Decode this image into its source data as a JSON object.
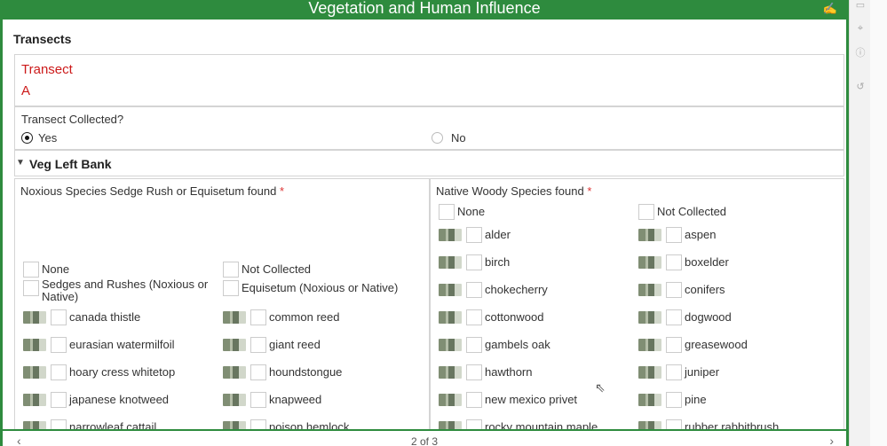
{
  "header": {
    "title": "Vegetation and Human Influence",
    "signature_icon": "signature-icon"
  },
  "group": {
    "title": "Transects"
  },
  "transect": {
    "label": "Transect",
    "value": "A"
  },
  "collected": {
    "question": "Transect Collected?",
    "options": [
      {
        "label": "Yes",
        "selected": true
      },
      {
        "label": "No",
        "selected": false
      }
    ]
  },
  "veg_left_bank": {
    "title": "Veg Left Bank",
    "noxious": {
      "label": "Noxious Species Sedge Rush or Equisetum found",
      "required_marker": "*",
      "options": [
        "None",
        "Not Collected",
        "Sedges and Rushes (Noxious or Native)",
        "Equisetum (Noxious or Native)",
        "canada thistle",
        "common reed",
        "eurasian watermilfoil",
        "giant reed",
        "hoary cress whitetop",
        "houndstongue",
        "japanese knotweed",
        "knapweed",
        "narrowleaf cattail",
        "poison hemlock"
      ]
    },
    "native_woody": {
      "label": "Native Woody Species found",
      "required_marker": "*",
      "options": [
        "None",
        "Not Collected",
        "alder",
        "aspen",
        "birch",
        "boxelder",
        "chokecherry",
        "conifers",
        "cottonwood",
        "dogwood",
        "gambels oak",
        "greasewood",
        "hawthorn",
        "juniper",
        "new mexico privet",
        "pine",
        "rocky mountain maple",
        "rubber rabbitbrush"
      ]
    }
  },
  "footer": {
    "prev_icon": "chevron-left-icon",
    "page_indicator": "2 of 3",
    "next_icon": "chevron-right-icon"
  },
  "colors": {
    "brand_green": "#2e8b3e",
    "required_red": "#cc1a1a"
  }
}
